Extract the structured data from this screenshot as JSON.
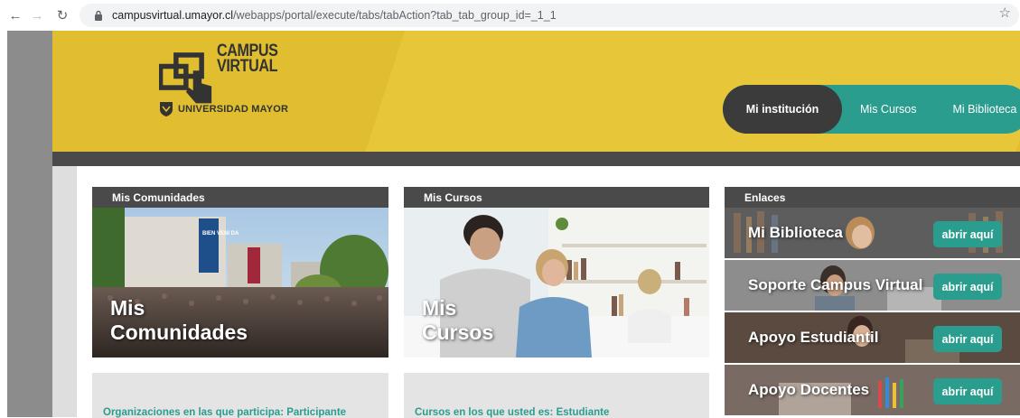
{
  "browser": {
    "url_host": "campusvirtual.umayor.cl",
    "url_path": "/webapps/portal/execute/tabs/tabAction?tab_tab_group_id=_1_1"
  },
  "header": {
    "logo_line1": "CAMPUS",
    "logo_line2": "VIRTUAL",
    "university": "UNIVERSIDAD MAYOR",
    "nav": [
      "Mi institución",
      "Mis Cursos",
      "Mi Biblioteca"
    ]
  },
  "panels": {
    "comunidades": {
      "title": "Mis Comunidades",
      "caption_line1": "Mis",
      "caption_line2": "Comunidades",
      "sign_text": "BIEN VENI DA",
      "footer": "Organizaciones en las que participa: Participante"
    },
    "cursos": {
      "title": "Mis Cursos",
      "caption_line1": "Mis",
      "caption_line2": "Cursos",
      "footer": "Cursos en los que usted es: Estudiante"
    },
    "enlaces": {
      "title": "Enlaces",
      "items": [
        {
          "label": "Mi Biblioteca",
          "button": "abrir aquí"
        },
        {
          "label": "Soporte Campus Virtual",
          "button": "abrir aquí"
        },
        {
          "label": "Apoyo Estudiantil",
          "button": "abrir aquí"
        },
        {
          "label": "Apoyo Docentes",
          "button": "abrir aquí"
        }
      ]
    }
  },
  "colors": {
    "banner_yellow": "#e0be2f",
    "teal": "#2a9d8f",
    "dark_gray": "#4a4a4a"
  }
}
